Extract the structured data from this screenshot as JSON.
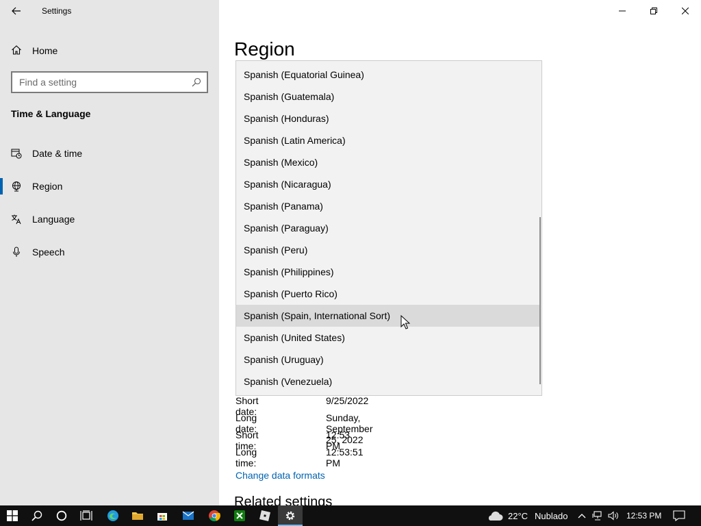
{
  "app": {
    "title": "Settings"
  },
  "sidebar": {
    "home_label": "Home",
    "search_placeholder": "Find a setting",
    "section": "Time & Language",
    "items": [
      {
        "label": "Date & time",
        "icon": "calendar-clock-icon"
      },
      {
        "label": "Region",
        "icon": "globe-icon",
        "active": true
      },
      {
        "label": "Language",
        "icon": "language-icon"
      },
      {
        "label": "Speech",
        "icon": "microphone-icon"
      }
    ]
  },
  "main": {
    "title": "Region",
    "formats": [
      {
        "key": "Short date:",
        "value": "9/25/2022"
      },
      {
        "key": "Long date:",
        "value": "Sunday, September 25, 2022"
      },
      {
        "key": "Short time:",
        "value": "12:53 PM"
      },
      {
        "key": "Long time:",
        "value": "12:53:51 PM"
      }
    ],
    "change_link": "Change data formats",
    "related_heading": "Related settings"
  },
  "dropdown": {
    "options": [
      "Spanish (Equatorial Guinea)",
      "Spanish (Guatemala)",
      "Spanish (Honduras)",
      "Spanish (Latin America)",
      "Spanish (Mexico)",
      "Spanish (Nicaragua)",
      "Spanish (Panama)",
      "Spanish (Paraguay)",
      "Spanish (Peru)",
      "Spanish (Philippines)",
      "Spanish (Puerto Rico)",
      "Spanish (Spain, International Sort)",
      "Spanish (United States)",
      "Spanish (Uruguay)",
      "Spanish (Venezuela)"
    ],
    "hovered": "Spanish (Spain, International Sort)"
  },
  "taskbar": {
    "weather_temp": "22°C",
    "weather_text": "Nublado",
    "time": "12:53 PM",
    "apps": [
      "start-icon",
      "search-icon",
      "cortana-icon",
      "task-view-icon",
      "edge-icon",
      "file-explorer-icon",
      "store-icon",
      "mail-icon",
      "chrome-icon",
      "xbox-icon",
      "roblox-icon",
      "settings-gear-icon"
    ]
  },
  "colors": {
    "accent": "#0063b1",
    "sidebar_bg": "#e6e6e6",
    "taskbar_bg": "#101010"
  }
}
